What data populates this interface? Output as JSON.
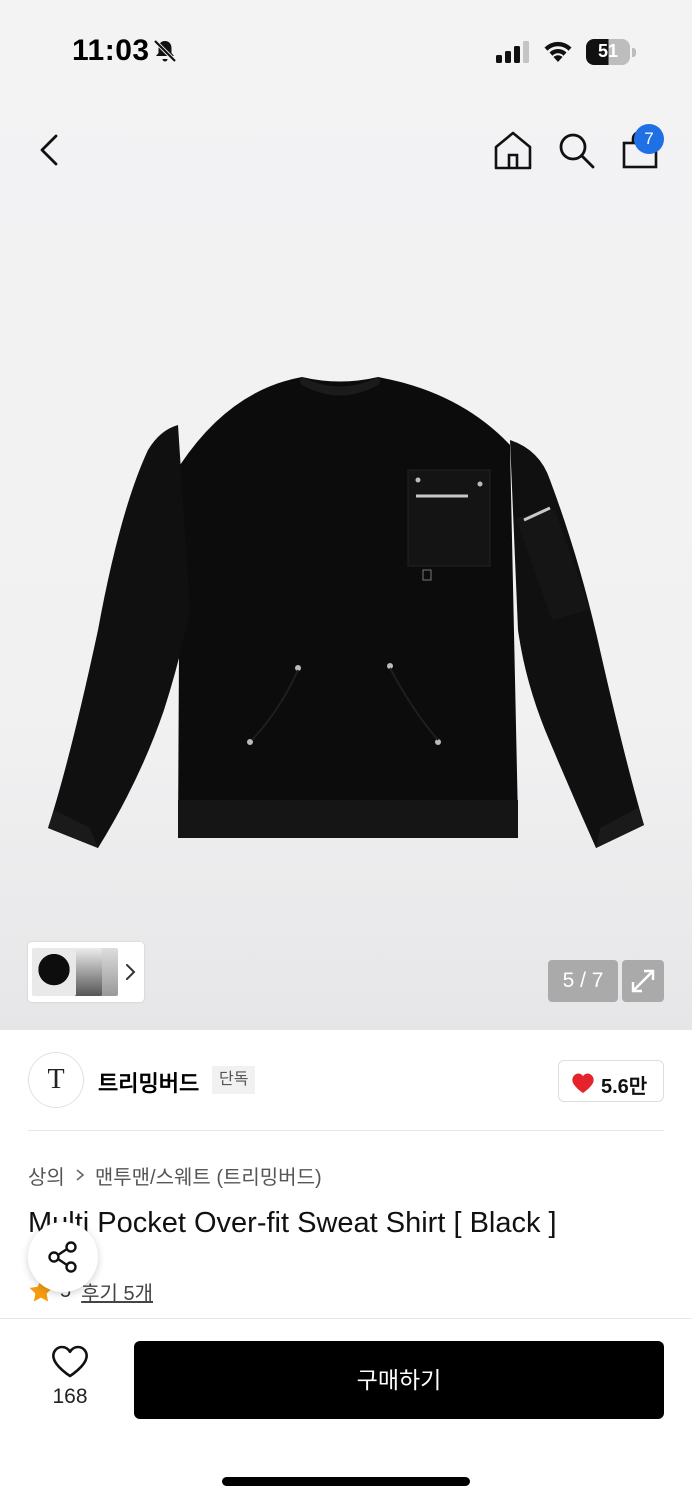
{
  "status_bar": {
    "time": "11:03",
    "battery": "51"
  },
  "nav": {
    "cart_count": "7"
  },
  "gallery": {
    "counter": "5 / 7"
  },
  "brand": {
    "logo_text": "T",
    "name": "트리밍버드",
    "tag": "단독",
    "likes": "5.6만"
  },
  "breadcrumb": {
    "category": "상의",
    "subcategory": "맨투맨/스웨트 (트리밍버드)"
  },
  "product": {
    "title": "Multi Pocket Over-fit Sweat Shirt [ Black ]",
    "rating": "5",
    "reviews": "후기 5개"
  },
  "bottom": {
    "wish_count": "168",
    "buy_label": "구매하기"
  },
  "colors": {
    "accent_blue": "#1f6fe5",
    "heart_red": "#e5232c",
    "star_orange": "#f39c12"
  }
}
